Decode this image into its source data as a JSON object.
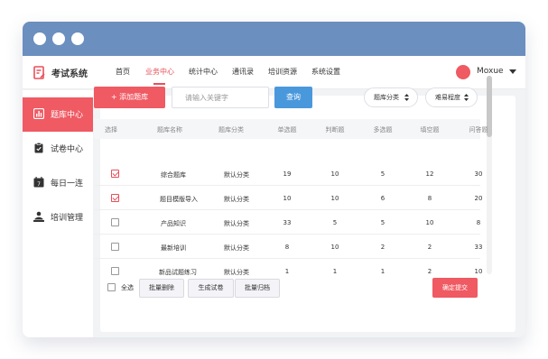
{
  "app": {
    "title": "考试系统"
  },
  "nav": {
    "items": [
      {
        "label": "首页",
        "active": false
      },
      {
        "label": "业务中心",
        "active": true
      },
      {
        "label": "统计中心",
        "active": false
      },
      {
        "label": "通讯录",
        "active": false
      },
      {
        "label": "培训资源",
        "active": false
      },
      {
        "label": "系统设置",
        "active": false
      }
    ]
  },
  "user": {
    "name": "Moxue"
  },
  "sidebar": {
    "items": [
      {
        "label": "题库中心",
        "icon": "bar-chart-icon",
        "active": true
      },
      {
        "label": "试卷中心",
        "icon": "clipboard-icon",
        "active": false
      },
      {
        "label": "每日一连",
        "icon": "calendar-icon",
        "active": false
      },
      {
        "label": "培训管理",
        "icon": "trainer-icon",
        "active": false
      }
    ]
  },
  "toolbar": {
    "add_label": "+ 添加题库",
    "search_placeholder": "请输入关键字",
    "search_label": "查询",
    "filter_category": "题库分类",
    "filter_difficulty": "难易程度"
  },
  "table": {
    "headers": [
      "选择",
      "题库名称",
      "题库分类",
      "单选题",
      "判断题",
      "多选题",
      "填空题",
      "问答题"
    ],
    "rows": [
      {
        "checked": true,
        "name": "综合题库",
        "category": "默认分类",
        "single": "19",
        "judge": "10",
        "multi": "5",
        "fill": "12",
        "qa": "30"
      },
      {
        "checked": true,
        "name": "题目模版导入",
        "category": "默认分类",
        "single": "10",
        "judge": "10",
        "multi": "6",
        "fill": "8",
        "qa": "20"
      },
      {
        "checked": false,
        "name": "产品知识",
        "category": "默认分类",
        "single": "33",
        "judge": "5",
        "multi": "5",
        "fill": "10",
        "qa": "8"
      },
      {
        "checked": false,
        "name": "最新培训",
        "category": "默认分类",
        "single": "8",
        "judge": "10",
        "multi": "2",
        "fill": "2",
        "qa": "33"
      },
      {
        "checked": false,
        "name": "新品试题练习",
        "category": "默认分类",
        "single": "1",
        "judge": "1",
        "multi": "1",
        "fill": "2",
        "qa": "10"
      }
    ]
  },
  "footer": {
    "select_all": "全选",
    "batch_delete": "批量删除",
    "generate_paper": "生成试卷",
    "batch_archive": "批量归档",
    "confirm_submit": "确定提交"
  },
  "colors": {
    "accent": "#ef5a63",
    "titlebar": "#6b8fbf",
    "search_button": "#4a98dc"
  }
}
